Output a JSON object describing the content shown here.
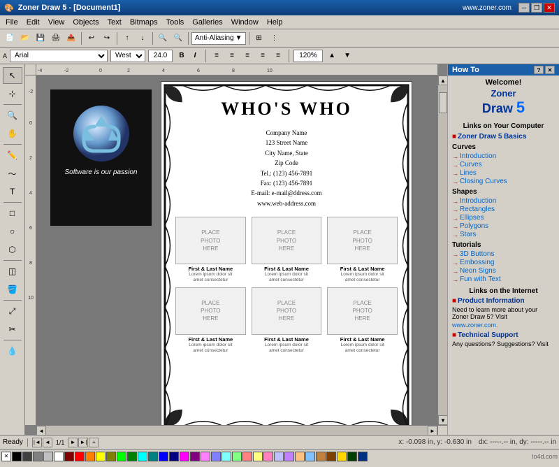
{
  "app": {
    "title": "Zoner Draw 5 - [Document1]",
    "website": "www.zoner.com",
    "icon": "🎨"
  },
  "titlebar": {
    "min": "─",
    "max": "□",
    "close": "✕",
    "restore": "❐"
  },
  "menu": {
    "items": [
      "File",
      "Edit",
      "View",
      "Objects",
      "Text",
      "Bitmaps",
      "Tools",
      "Galleries",
      "Window",
      "Help"
    ]
  },
  "toolbar": {
    "antialias": "Anti-Aliasing"
  },
  "formatbar": {
    "font": "Arial",
    "align": "West",
    "size": "24.0",
    "bold": "B",
    "italic": "I",
    "zoom": "120%"
  },
  "document": {
    "black_page": {
      "tagline": "Software is our passion"
    },
    "white_page": {
      "title": "WHO'S WHO",
      "company": "Company Name",
      "address1": "123 Street Name",
      "address2": "City Name, State",
      "zipcode": "Zip Code",
      "tel": "Tel.: (123) 456-7891",
      "fax": "Fax: (123) 456-7891",
      "email": "E-mail: e-mail@ddress.com",
      "web": "www.web-address.com",
      "photos": [
        {
          "label": "PLACE\nPHOTO\nHERE",
          "name": "First & Last Name",
          "desc": "Lorem ipsum dolor sit\namet consectetur"
        },
        {
          "label": "PLACE\nPHOTO\nHERE",
          "name": "First & Last Name",
          "desc": "Lorem ipsum dolor sit\namet consectetur"
        },
        {
          "label": "PLACE\nPHOTO\nHERE",
          "name": "First & Last Name",
          "desc": "Lorem ipsum dolor sit\namet consectetur"
        },
        {
          "label": "PLACE\nPHOTO\nHERE",
          "name": "First & Last Name",
          "desc": "Lorem ipsum dolor sit\namet consectetur"
        },
        {
          "label": "PLACE\nPHOTO\nHERE",
          "name": "First & Last Name",
          "desc": "Lorem ipsum dolor sit\namet consectetur"
        },
        {
          "label": "PLACE\nPHOTO\nHERE",
          "name": "First & Last Name",
          "desc": "Lorem ipsum dolor sit\namet consectetur"
        }
      ]
    }
  },
  "howto": {
    "title": "How To",
    "question_btn": "?",
    "welcome": "Welcome!",
    "draw5": "Draw",
    "draw5_num": "5",
    "sections": [
      {
        "type": "bullet",
        "label": "Links on Your Computer"
      },
      {
        "type": "bullet",
        "label": "Zoner Draw 5 Basics"
      },
      {
        "type": "group",
        "heading": "Curves",
        "links": [
          "Introduction",
          "Curves",
          "Lines",
          "Closing Curves"
        ]
      },
      {
        "type": "group",
        "heading": "Shapes",
        "links": [
          "Introduction",
          "Rectangles",
          "Ellipses",
          "Polygons",
          "Stars"
        ]
      },
      {
        "type": "group",
        "heading": "Tutorials",
        "links": [
          "3D Buttons",
          "Embossing",
          "Neon Signs",
          "Fun with Text"
        ]
      },
      {
        "type": "bullet",
        "label": "Links on the Internet"
      },
      {
        "type": "bullet",
        "label": "Product Information"
      }
    ],
    "product_info": "Need to learn more about your Zoner Draw 5? Visit",
    "zoner_link": "www.zoner.com.",
    "support_heading": "Technical Support",
    "support_text": "Any questions? Suggestions? Visit"
  },
  "statusbar": {
    "ready": "Ready",
    "page": "1/1",
    "coords": "x: -0.098 in, y: -0.630 in",
    "dx_dy": "dx: -----.-- in, dy: -----.-- in"
  },
  "colors": [
    "#000000",
    "#808080",
    "#c0c0c0",
    "#ffffff",
    "#800000",
    "#ff0000",
    "#ff8000",
    "#ffff00",
    "#808000",
    "#00ff00",
    "#008000",
    "#00ffff",
    "#008080",
    "#0000ff",
    "#000080",
    "#ff00ff",
    "#800080",
    "#ff80ff",
    "#8080ff",
    "#80ffff",
    "#80ff80",
    "#ff8080",
    "#ffff80",
    "#ff80c0",
    "#c0c0ff",
    "#c080ff"
  ]
}
